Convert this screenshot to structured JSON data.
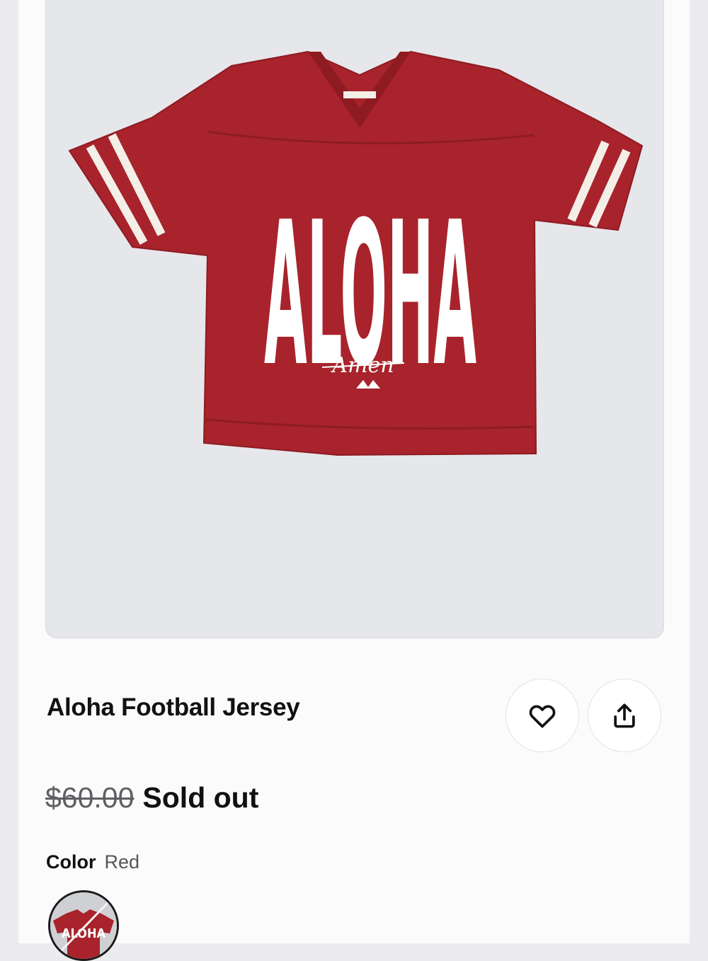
{
  "product": {
    "title": "Aloha Football Jersey",
    "image_alt": "Red mesh football jersey with white ALOHA print",
    "print_text": "ALOHA",
    "print_signature": "Amen"
  },
  "actions": {
    "favorite_icon": "heart-icon",
    "share_icon": "share-icon"
  },
  "pricing": {
    "original_price": "$60.00",
    "status": "Sold out"
  },
  "options": {
    "color_label": "Color",
    "color_value": "Red",
    "swatches": [
      {
        "name": "Red",
        "available": false
      }
    ]
  },
  "colors": {
    "jersey": "#a8232b",
    "jersey_shadow": "#8e1b22",
    "stripe": "#f4eee8",
    "image_bg": "#e6e7eb",
    "text": "#111111",
    "muted": "#5f5f63"
  }
}
